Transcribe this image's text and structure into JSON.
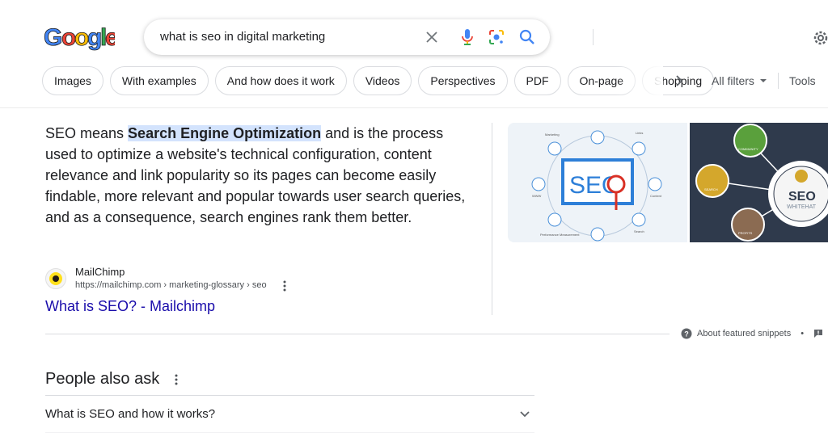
{
  "search": {
    "query": "what is seo in digital marketing",
    "logo_text": "Google"
  },
  "chips": [
    "Images",
    "With examples",
    "And how does it work",
    "Videos",
    "Perspectives",
    "PDF",
    "On-page",
    "Shopping"
  ],
  "filters": {
    "all_filters": "All filters",
    "tools": "Tools"
  },
  "snippet": {
    "text_before": "SEO means ",
    "highlight": "Search Engine Optimization",
    "text_after": " and is the process used to optimize a website's technical configuration, content relevance and link popularity so its pages can become easily findable, more relevant and popular towards user search queries, and as a consequence, search engines rank them better.",
    "source_name": "MailChimp",
    "source_url": "https://mailchimp.com › marketing-glossary › seo",
    "link_title": "What is SEO? - Mailchimp",
    "about": "About featured snippets",
    "about_sep": "•"
  },
  "images": {
    "img1": {
      "center_text": "SEO",
      "labels": [
        "Marketing",
        "Links",
        "Content",
        "Search",
        "Performance Measurement",
        "WWW"
      ]
    },
    "img2": {
      "center_text": "SEO",
      "sub_text": "WHITEHAT",
      "labels": [
        "COMMUNITY",
        "SEARCH",
        "PROFITS"
      ]
    }
  },
  "paa": {
    "title": "People also ask",
    "questions": [
      "What is SEO and how it works?"
    ]
  },
  "colors": {
    "link": "#1a0dab",
    "highlight": "#d3e3fd",
    "text": "#202124",
    "muted": "#4d5156",
    "blue": "#4285f4"
  }
}
